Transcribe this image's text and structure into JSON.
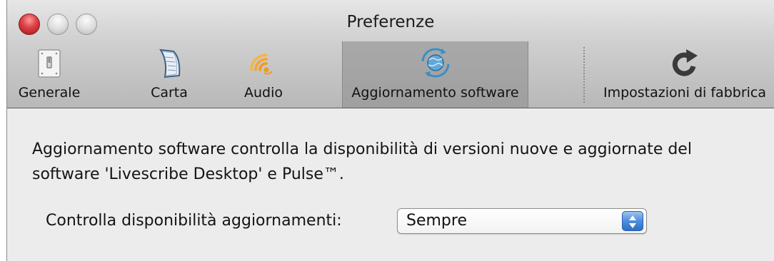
{
  "window": {
    "title": "Preferenze"
  },
  "toolbar": {
    "items": [
      {
        "label": "Generale",
        "icon": "switch-icon"
      },
      {
        "label": "Carta",
        "icon": "paper-icon"
      },
      {
        "label": "Audio",
        "icon": "audio-waves-icon"
      },
      {
        "label": "Aggiornamento software",
        "icon": "globe-refresh-icon",
        "selected": true
      },
      {
        "label": "Impostazioni di fabbrica",
        "icon": "reset-arrow-icon"
      }
    ]
  },
  "content": {
    "description": "Aggiornamento software controlla la disponibilità di versioni nuove e aggiornate del software 'Livescribe Desktop' e Pulse™.",
    "check_label": "Controlla disponibilità aggiornamenti:",
    "check_value": "Sempre"
  },
  "colors": {
    "close_button": "#e0454a",
    "popup_stepper": "#4d8ede",
    "audio_icon": "#f39a1c"
  }
}
